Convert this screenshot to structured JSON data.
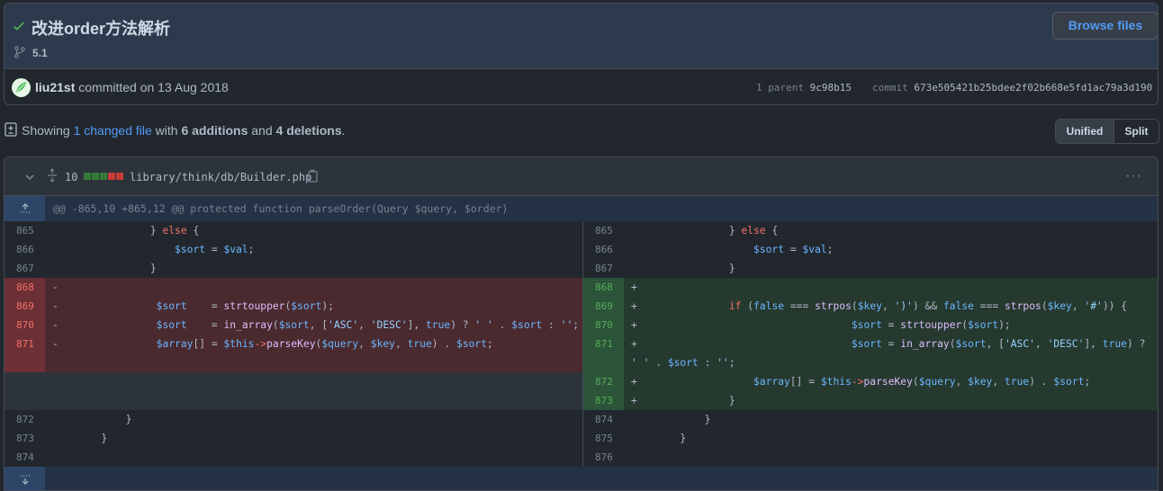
{
  "commit": {
    "title": "改进order方法解析",
    "branch": "5.1",
    "browse_label": "Browse files",
    "author": "liu21st",
    "committed_text": "committed on 13 Aug 2018",
    "parent_label": "1 parent",
    "parent_sha": "9c98b15",
    "commit_label": "commit",
    "commit_sha": "673e505421b25bdee2f02b668e5fd1ac79a3d190"
  },
  "summary": {
    "showing": "Showing ",
    "changed_link": "1 changed file",
    "with": " with ",
    "additions": "6 additions",
    "and": " and ",
    "deletions": "4 deletions",
    "period": "."
  },
  "view_toggle": {
    "unified": "Unified",
    "split": "Split",
    "selected": "Unified"
  },
  "file": {
    "change_count": "10",
    "name": "library/think/db/Builder.php",
    "hunk_header": "@@ -865,10 +865,12 @@ protected function parseOrder(Query $query, $order)"
  },
  "left_lines": [
    {
      "n": "865",
      "type": "ctx",
      "text": "                } else {"
    },
    {
      "n": "866",
      "type": "ctx",
      "text": "                    $sort = $val;"
    },
    {
      "n": "867",
      "type": "ctx",
      "text": "                }"
    },
    {
      "n": "868",
      "type": "del",
      "text": "-"
    },
    {
      "n": "869",
      "type": "del",
      "text": "-                $sort    = strtoupper($sort);"
    },
    {
      "n": "870",
      "type": "del",
      "text": "-                $sort    = in_array($sort, ['ASC', 'DESC'], true) ? ' ' . $sort : '';"
    },
    {
      "n": "871",
      "type": "del",
      "text": "-                $array[] = $this->parseKey($query, $key, true) . $sort;"
    },
    {
      "n": "",
      "type": "del-empty",
      "text": ""
    },
    {
      "n": "",
      "type": "empty",
      "text": ""
    },
    {
      "n": "",
      "type": "empty",
      "text": ""
    },
    {
      "n": "872",
      "type": "ctx",
      "text": "            }"
    },
    {
      "n": "873",
      "type": "ctx",
      "text": "        }"
    },
    {
      "n": "874",
      "type": "ctx",
      "text": ""
    }
  ],
  "right_lines": [
    {
      "n": "865",
      "type": "ctx",
      "text": "                } else {"
    },
    {
      "n": "866",
      "type": "ctx",
      "text": "                    $sort = $val;"
    },
    {
      "n": "867",
      "type": "ctx",
      "text": "                }"
    },
    {
      "n": "868",
      "type": "add",
      "text": "+"
    },
    {
      "n": "869",
      "type": "add",
      "text": "+               if (false === strpos($key, ')') && false === strpos($key, '#')) {"
    },
    {
      "n": "870",
      "type": "add",
      "text": "+                                   $sort = strtoupper($sort);"
    },
    {
      "n": "871",
      "type": "add",
      "text": "+                                   $sort = in_array($sort, ['ASC', 'DESC'], true) ?"
    },
    {
      "n": "",
      "type": "add-cont",
      "text": "' ' . $sort : '';"
    },
    {
      "n": "872",
      "type": "add",
      "text": "+                   $array[] = $this->parseKey($query, $key, true) . $sort;"
    },
    {
      "n": "873",
      "type": "add",
      "text": "+               }"
    },
    {
      "n": "874",
      "type": "ctx",
      "text": "            }"
    },
    {
      "n": "875",
      "type": "ctx",
      "text": "        }"
    },
    {
      "n": "876",
      "type": "ctx",
      "text": ""
    }
  ],
  "colors": {
    "del_bg": "#4a2a2f",
    "del_gutter": "#6b2f35",
    "add_bg": "#26392f",
    "add_gutter": "#2b5438",
    "ctx_bg": "#22272e"
  }
}
